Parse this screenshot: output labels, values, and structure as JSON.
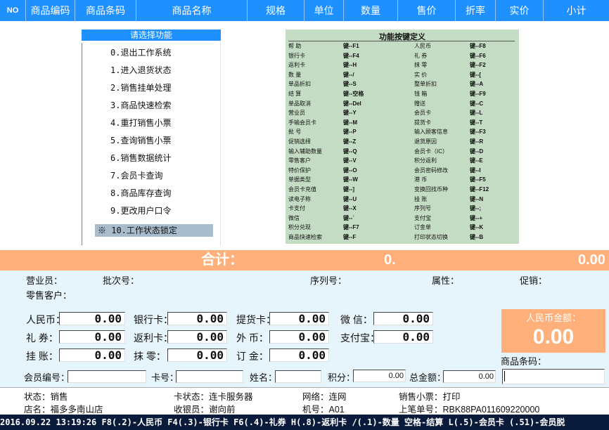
{
  "header": {
    "no": "NO",
    "code": "商品编码",
    "barcode": "商品条码",
    "name": "商品名称",
    "spec": "规格",
    "unit": "单位",
    "qty": "数量",
    "price": "售价",
    "discount": "折率",
    "actual": "实价",
    "subtotal": "小计"
  },
  "menu": {
    "title": "请选择功能",
    "items": [
      "0.退出工作系统",
      "1.进入退货状态",
      "2.销售挂单处理",
      "3.商品快速检索",
      "4.重打销售小票",
      "5.查询销售小票",
      "6.销售数据统计",
      "7.会员卡查询",
      "8.商品库存查询",
      "9.更改用户口令",
      "※ 10.工作状态锁定"
    ]
  },
  "keys": {
    "title": "功能按键定义",
    "left": [
      [
        "帮  助",
        "键--F1"
      ],
      [
        "银行卡",
        "键--F4"
      ],
      [
        "返利卡",
        "键--H"
      ],
      [
        "数  量",
        "键--/"
      ],
      [
        "单品折扣",
        "键--S"
      ],
      [
        "结  算",
        "键--空格"
      ],
      [
        "单品取消",
        "键--Del"
      ],
      [
        "营业员",
        "键--Y"
      ],
      [
        "手输会员卡",
        "键--M"
      ],
      [
        "批  号",
        "键--P"
      ],
      [
        "促销选择",
        "键--Z"
      ],
      [
        "输入辅助数量",
        "键--Q"
      ],
      [
        "零售客户",
        "键--V"
      ],
      [
        "特价保护",
        "键--O"
      ],
      [
        "单据类型",
        "键--W"
      ],
      [
        "会员卡充值",
        "键--]"
      ],
      [
        "读电子称",
        "键--U"
      ],
      [
        "卡支付",
        "键--X"
      ],
      [
        "微信",
        "键--`"
      ],
      [
        "积分兑现",
        "键--F7"
      ],
      [
        "商品快速检索",
        "键--F"
      ]
    ],
    "right": [
      [
        "人民币",
        "键--F8"
      ],
      [
        "礼  券",
        "键--F6"
      ],
      [
        "抹  零",
        "键--F2"
      ],
      [
        "实  价",
        "键--["
      ],
      [
        "整单折扣",
        "键--A"
      ],
      [
        "钱  箱",
        "键--F9"
      ],
      [
        "赠送",
        "键--C"
      ],
      [
        "会员卡",
        "键--L"
      ],
      [
        "提货卡",
        "键--T"
      ],
      [
        "输入顾客信息",
        "键--F3"
      ],
      [
        "退货原因",
        "键--R"
      ],
      [
        "会员卡（IC）",
        "键--D"
      ],
      [
        "积分返利",
        "键--E"
      ],
      [
        "会员密码修改",
        "键--I"
      ],
      [
        "港  币",
        "键--F5"
      ],
      [
        "变换回找币种",
        "键--F12"
      ],
      [
        "挂  账",
        "键--N"
      ],
      [
        "序列号",
        "键--;"
      ],
      [
        "支付宝",
        "键--+"
      ],
      [
        "订金单",
        "键--K"
      ],
      [
        "打印状态切换",
        "键--B"
      ]
    ]
  },
  "total": {
    "label": "合计：",
    "qty": "0.",
    "amount": "0.00"
  },
  "info": {
    "salesperson": "营业员：",
    "batch": "批次号：",
    "serial": "序列号：",
    "attribute": "属性：",
    "promotion": "促销：",
    "customer": "零售客户："
  },
  "payment": {
    "rmb_label": "人民币：",
    "rmb": "0.00",
    "bank_label": "银行卡：",
    "bank": "0.00",
    "pickup_label": "提货卡：",
    "pickup": "0.00",
    "wechat_label": "微  信：",
    "wechat": "0.00",
    "gift_label": "礼  券：",
    "gift": "0.00",
    "rebate_label": "返利卡：",
    "rebate": "0.00",
    "foreign_label": "外  币：",
    "foreign": "0.00",
    "alipay_label": "支付宝：",
    "alipay": "0.00",
    "credit_label": "挂  账：",
    "credit": "0.00",
    "round_label": "抹  零：",
    "round": "0.00",
    "deposit_label": "订  金：",
    "deposit": "0.00"
  },
  "rmb_amount": {
    "label": "人民币金额：",
    "value": "0.00"
  },
  "member": {
    "member_no_label": "会员编号：",
    "card_label": "卡号：",
    "name_label": "姓名：",
    "points_label": "积分：",
    "points": "0.00",
    "total_label": "总金额：",
    "total": "0.00",
    "barcode_label": "商品条码："
  },
  "status": {
    "state": "状态：销售",
    "card_state": "卡状态：连卡服务器",
    "network": "网络：连网",
    "receipt": "销售小票：打印",
    "store": "店名：福多多南山店",
    "cashier": "收银员：谢向前",
    "machine": "机号：A01",
    "last_doc": "上笔单号：RBK88PA011609220000"
  },
  "bottom": {
    "text": "2016.09.22 13:19:26 F8(.2)-人民币 F4(.3)-银行卡 F6(.4)-礼券 H(.8)-返利卡 /(.1)-数量 空格-结算 L(.5)-会员卡 (.51)-会员脱"
  }
}
